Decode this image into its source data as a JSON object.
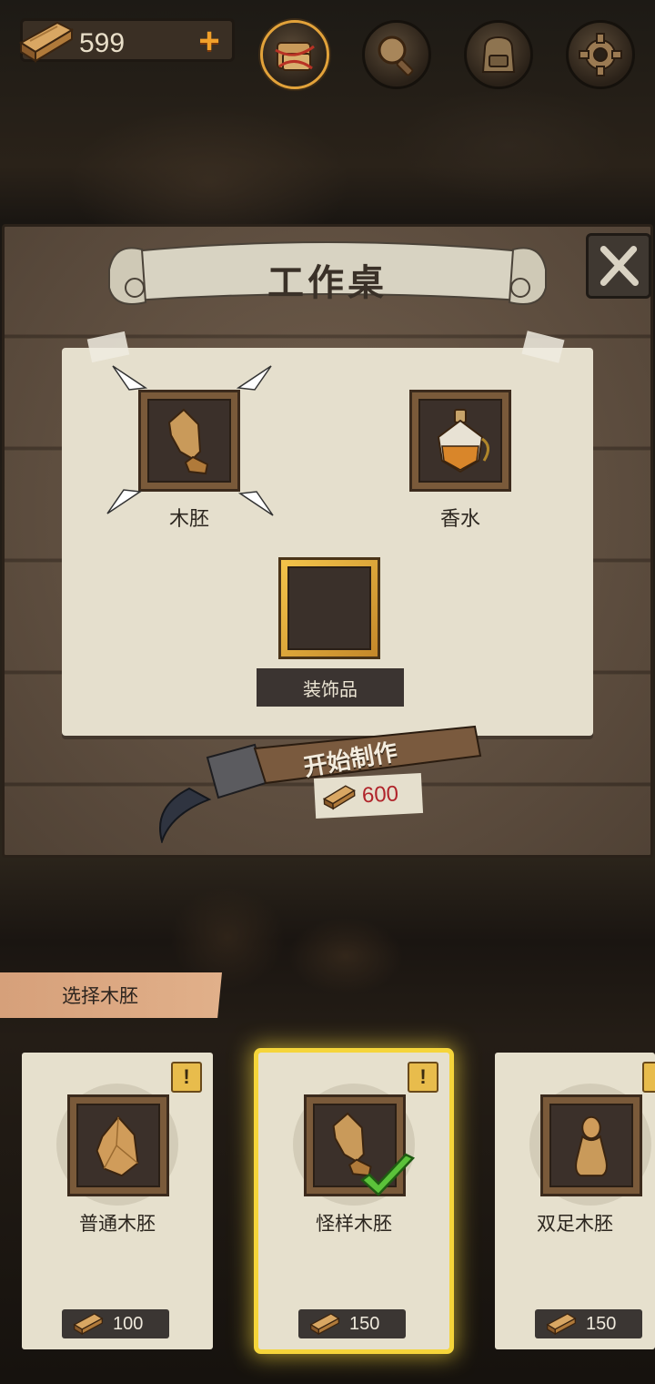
{
  "header": {
    "currency_amount": "599",
    "currency_icon": "wood-plank-icon",
    "add_icon": "plus-icon",
    "nav_buttons": [
      {
        "name": "crafting-bundle-icon",
        "active": true
      },
      {
        "name": "magnifier-icon",
        "active": false
      },
      {
        "name": "backpack-icon",
        "active": false
      },
      {
        "name": "gear-icon",
        "active": false
      }
    ]
  },
  "workbench": {
    "title": "工作桌",
    "slots": [
      {
        "label": "木胚",
        "icon": "wooden-blank-icon",
        "selected": true
      },
      {
        "label": "香水",
        "icon": "perfume-bottle-icon",
        "selected": false
      },
      {
        "label": "装饰品",
        "icon": "empty-slot",
        "selected": false
      }
    ],
    "start_button": "开始制作",
    "cost": "600",
    "accent_color": "#e2a23a"
  },
  "selector": {
    "tab_label": "选择木胚",
    "items": [
      {
        "name": "普通木胚",
        "price": "100",
        "selected": false,
        "icon": "rough-blank-icon"
      },
      {
        "name": "怪样木胚",
        "price": "150",
        "selected": true,
        "icon": "odd-blank-icon"
      },
      {
        "name": "双足木胚",
        "price": "150",
        "selected": false,
        "icon": "twin-foot-blank-icon"
      }
    ],
    "info_mark": "!",
    "highlight_color": "#f5d53a"
  }
}
